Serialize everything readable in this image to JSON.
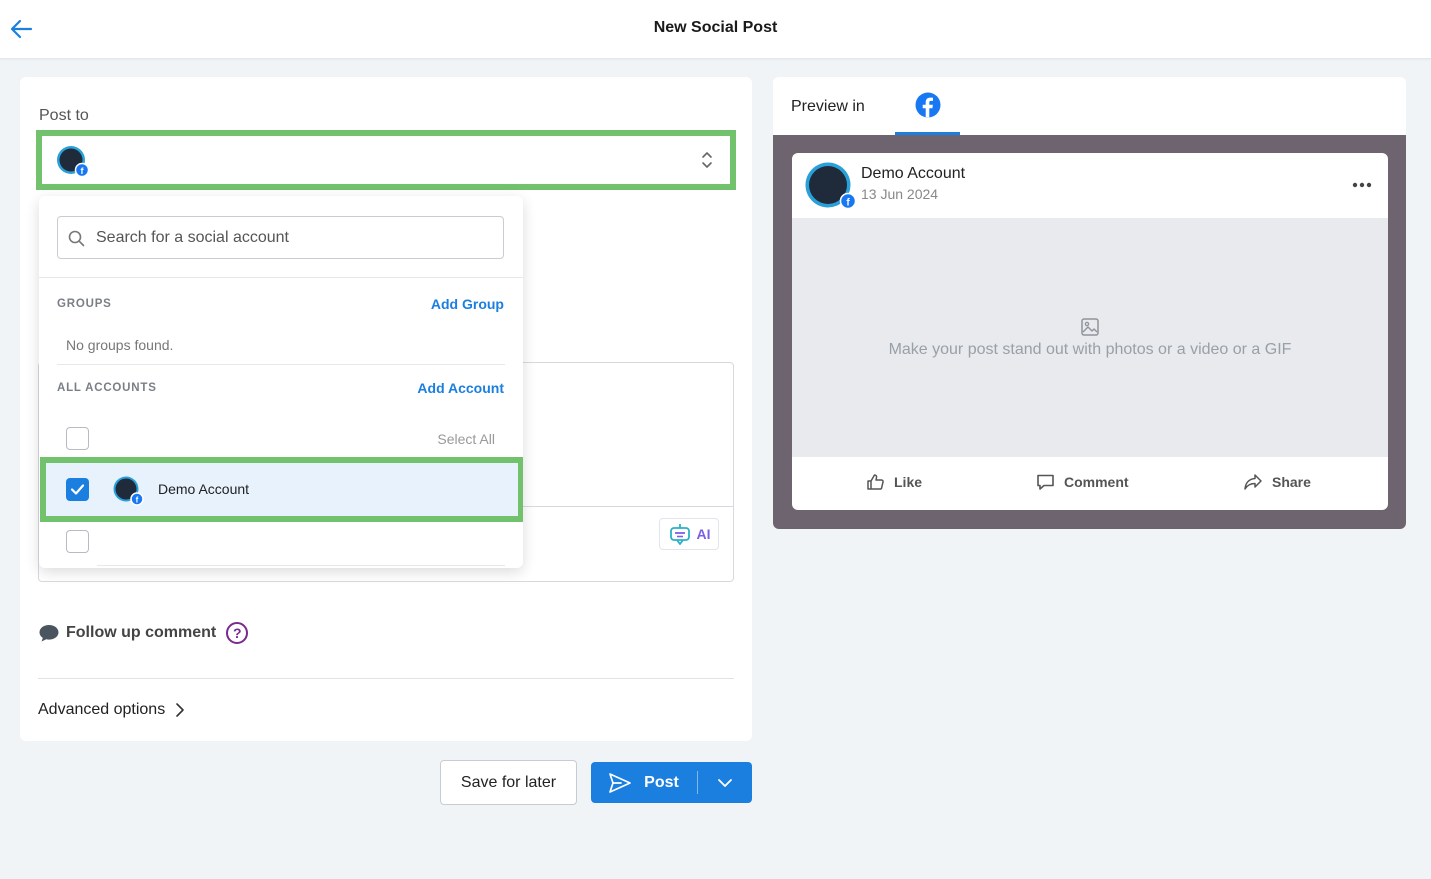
{
  "header": {
    "title": "New Social Post"
  },
  "composer": {
    "post_to_label": "Post to",
    "follow_up_label": "Follow up comment",
    "help_symbol": "?",
    "advanced_label": "Advanced options",
    "ai_label": "AI"
  },
  "dropdown": {
    "search_placeholder": "Search for a social account",
    "groups_title": "GROUPS",
    "add_group_label": "Add Group",
    "no_groups_text": "No groups found.",
    "accounts_title": "ALL ACCOUNTS",
    "add_account_label": "Add Account",
    "select_all_label": "Select All",
    "accounts": [
      {
        "name": "Demo Account",
        "checked": true,
        "network": "facebook"
      }
    ]
  },
  "preview": {
    "label": "Preview in",
    "network_tab": "facebook-icon",
    "account_name": "Demo Account",
    "post_date": "13 Jun 2024",
    "media_prompt": "Make your post stand out with photos or a video or a GIF",
    "actions": {
      "like": "Like",
      "comment": "Comment",
      "share": "Share"
    }
  },
  "footer": {
    "save_label": "Save for later",
    "post_label": "Post"
  },
  "colors": {
    "accent": "#1b7fe0",
    "highlight": "#72c16d",
    "preview_bg": "#6e646f",
    "help_purple": "#7b2a8f"
  }
}
